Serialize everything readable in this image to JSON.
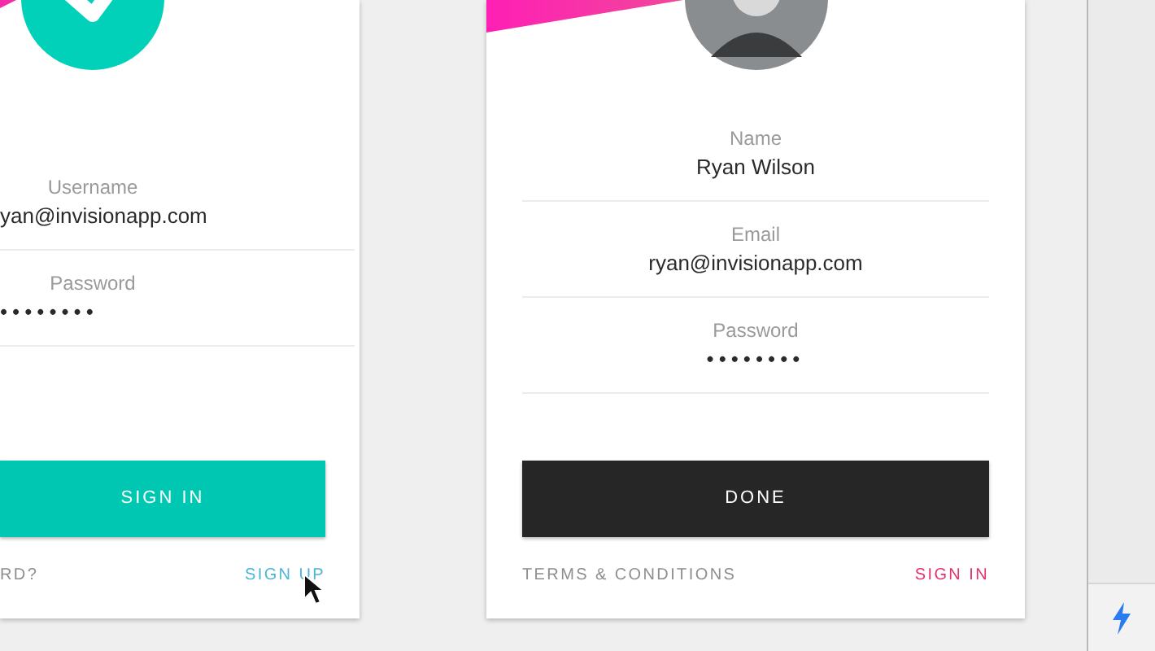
{
  "cards": [
    {
      "kind": "sign_in",
      "fields": [
        {
          "label": "Username",
          "value": "yan@invisionapp.com"
        },
        {
          "label": "Password",
          "value": "••••••••"
        }
      ],
      "button": "SIGN IN",
      "footer_left": "RD?",
      "footer_right": "SIGN UP"
    },
    {
      "kind": "sign_up",
      "fields": [
        {
          "label": "Name",
          "value": "Ryan Wilson"
        },
        {
          "label": "Email",
          "value": "ryan@invisionapp.com"
        },
        {
          "label": "Password",
          "value": "••••••••"
        }
      ],
      "button": "DONE",
      "footer_left": "TERMS & CONDITIONS",
      "footer_right": "SIGN IN"
    }
  ]
}
